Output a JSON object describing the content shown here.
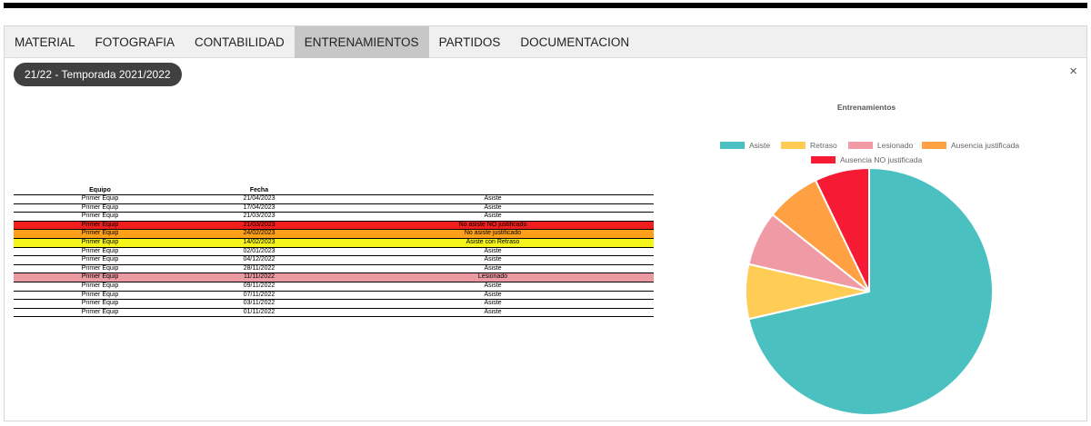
{
  "tabs": [
    "MATERIAL",
    "FOTOGRAFIA",
    "CONTABILIDAD",
    "ENTRENAMIENTOS",
    "PARTIDOS",
    "DOCUMENTACION"
  ],
  "active_tab": "ENTRENAMIENTOS",
  "season_label": "21/22 - Temporada 2021/2022",
  "close_label": "×",
  "table": {
    "headers": [
      "Equipo",
      "Fecha",
      ""
    ],
    "rows": [
      {
        "equipo": "Primer Equip",
        "fecha": "21/04/2023",
        "estado": "Asiste",
        "color": ""
      },
      {
        "equipo": "Primer Equip",
        "fecha": "17/04/2023",
        "estado": "Asiste",
        "color": ""
      },
      {
        "equipo": "Primer Equip",
        "fecha": "21/03/2023",
        "estado": "Asiste",
        "color": ""
      },
      {
        "equipo": "Primer Equip",
        "fecha": "21/03/2023",
        "estado": "No asiste NO justificado",
        "color": "#f21d1d"
      },
      {
        "equipo": "Primer Equip",
        "fecha": "24/02/2023",
        "estado": "No asiste justificado",
        "color": "#ff9f1a"
      },
      {
        "equipo": "Primer Equip",
        "fecha": "14/02/2023",
        "estado": "Asiste con Retraso",
        "color": "#f5f51c"
      },
      {
        "equipo": "Primer Equip",
        "fecha": "02/01/2023",
        "estado": "Asiste",
        "color": ""
      },
      {
        "equipo": "Primer Equip",
        "fecha": "04/12/2022",
        "estado": "Asiste",
        "color": ""
      },
      {
        "equipo": "Primer Equip",
        "fecha": "28/11/2022",
        "estado": "Asiste",
        "color": ""
      },
      {
        "equipo": "Primer Equip",
        "fecha": "11/11/2022",
        "estado": "Lesionado",
        "color": "#ec9aa2"
      },
      {
        "equipo": "Primer Equip",
        "fecha": "09/11/2022",
        "estado": "Asiste",
        "color": ""
      },
      {
        "equipo": "Primer Equip",
        "fecha": "07/11/2022",
        "estado": "Asiste",
        "color": ""
      },
      {
        "equipo": "Primer Equip",
        "fecha": "03/11/2022",
        "estado": "Asiste",
        "color": ""
      },
      {
        "equipo": "Primer Equip",
        "fecha": "01/11/2022",
        "estado": "Asiste",
        "color": ""
      }
    ]
  },
  "chart_data": {
    "type": "pie",
    "title": "Entrenamientos",
    "legend_position": "top",
    "labels": [
      "Asiste",
      "Retraso",
      "Lesionado",
      "Ausencia justificada",
      "Ausencia NO justificada"
    ],
    "values": [
      10,
      1,
      1,
      1,
      1
    ],
    "colors": [
      "#4bc0c0",
      "#ffcd56",
      "#ef9aa4",
      "#ffa143",
      "#f71a34"
    ]
  }
}
